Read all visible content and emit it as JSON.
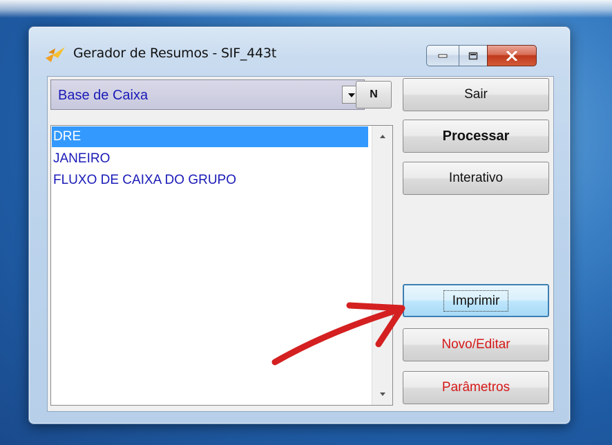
{
  "window": {
    "title": "Gerador de Resumos - SIF_443t",
    "controls": [
      "minimize-icon",
      "maximize-icon",
      "close-icon"
    ]
  },
  "combo": {
    "value": "Base de Caixa"
  },
  "n_button": {
    "label": "N"
  },
  "list": {
    "items": [
      {
        "label": "DRE",
        "selected": true
      },
      {
        "label": "JANEIRO",
        "selected": false
      },
      {
        "label": "FLUXO DE CAIXA DO GRUPO",
        "selected": false
      }
    ]
  },
  "buttons": {
    "sair": "Sair",
    "processar": "Processar",
    "interativo": "Interativo",
    "imprimir": "Imprimir",
    "novo_editar": "Novo/Editar",
    "parametros": "Parâmetros"
  },
  "colors": {
    "list_text": "#1a1ab8",
    "selection": "#3399ff",
    "red_label": "#d61818",
    "annotation_arrow": "#d42020"
  }
}
